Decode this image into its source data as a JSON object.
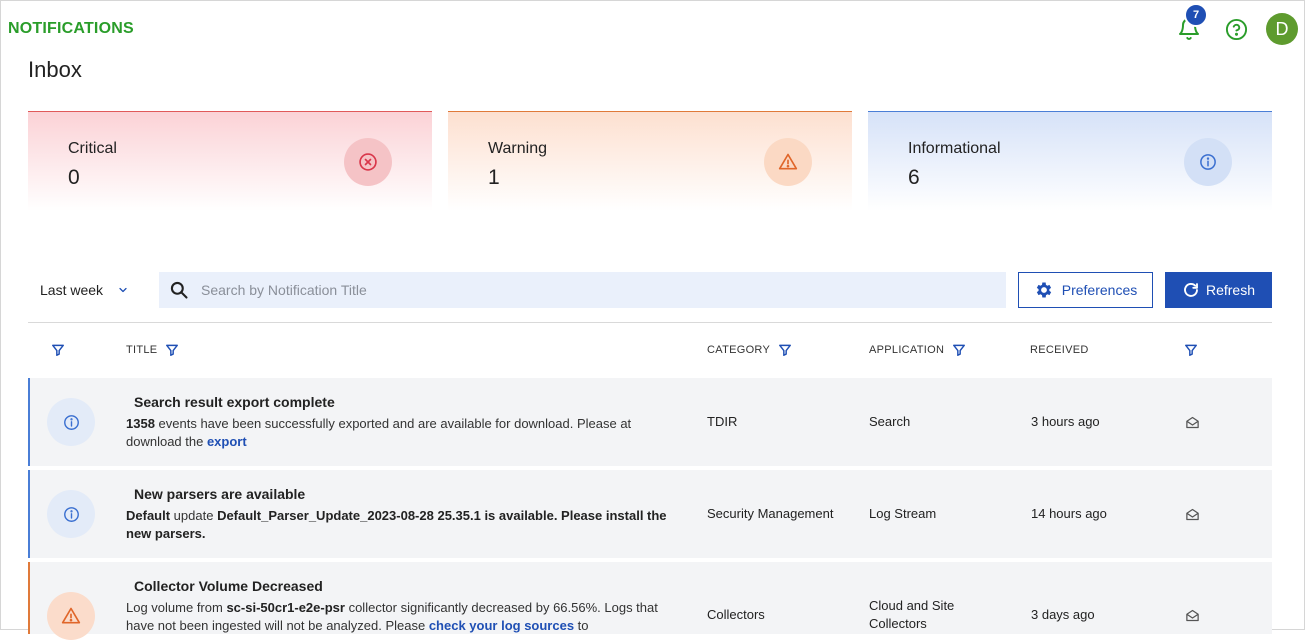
{
  "header": {
    "app_title": "NOTIFICATIONS",
    "bell_count": "7",
    "avatar_initial": "D"
  },
  "page_title": "Inbox",
  "summary": [
    {
      "label": "Critical",
      "count": "0"
    },
    {
      "label": "Warning",
      "count": "1"
    },
    {
      "label": "Informational",
      "count": "6"
    }
  ],
  "toolbar": {
    "range": "Last week",
    "search_placeholder": "Search by Notification Title",
    "preferences_label": "Preferences",
    "refresh_label": "Refresh"
  },
  "columns": {
    "title": "TITLE",
    "category": "CATEGORY",
    "application": "APPLICATION",
    "received": "RECEIVED"
  },
  "rows": [
    {
      "severity": "info",
      "title": "Search result export complete",
      "desc_bold1": "1358",
      "desc_text1": " events have been successfully exported and are available for download. Please at download the ",
      "desc_link": "export",
      "category": "TDIR",
      "application": "Search",
      "received": "3 hours ago"
    },
    {
      "severity": "info",
      "title": "New parsers are available",
      "desc_bold1": "Default",
      "desc_text1": " update ",
      "desc_bold2": "Default_Parser_Update_2023-08-28 25.35.1 is available. Please install the new parsers.",
      "category": "Security Management",
      "application": "Log Stream",
      "received": "14 hours ago"
    },
    {
      "severity": "warning",
      "title": "Collector Volume Decreased",
      "desc_text0": "Log volume from ",
      "desc_bold1": "sc-si-50cr1-e2e-psr",
      "desc_text1": " collector significantly decreased by 66.56%. Logs that have not been ingested will not be analyzed. Please ",
      "desc_link": "check your log sources",
      "desc_text2": " to",
      "category": "Collectors",
      "application": "Cloud and Site Collectors",
      "received": "3 days ago"
    }
  ],
  "colors": {
    "brand_green": "#2a9d2a",
    "primary_blue": "#1f4fb4",
    "critical": "#e05a5a",
    "warning": "#e07a3a",
    "info": "#4a7ed6"
  },
  "icons": {
    "bell": "bell-icon",
    "help": "help-circle-icon",
    "critical": "x-circle-icon",
    "warning": "warning-triangle-icon",
    "info": "info-circle-icon",
    "search": "search-icon",
    "gear": "gear-icon",
    "refresh": "refresh-icon",
    "filter": "filter-icon",
    "mail": "envelope-open-icon",
    "chevron": "chevron-down-icon"
  }
}
